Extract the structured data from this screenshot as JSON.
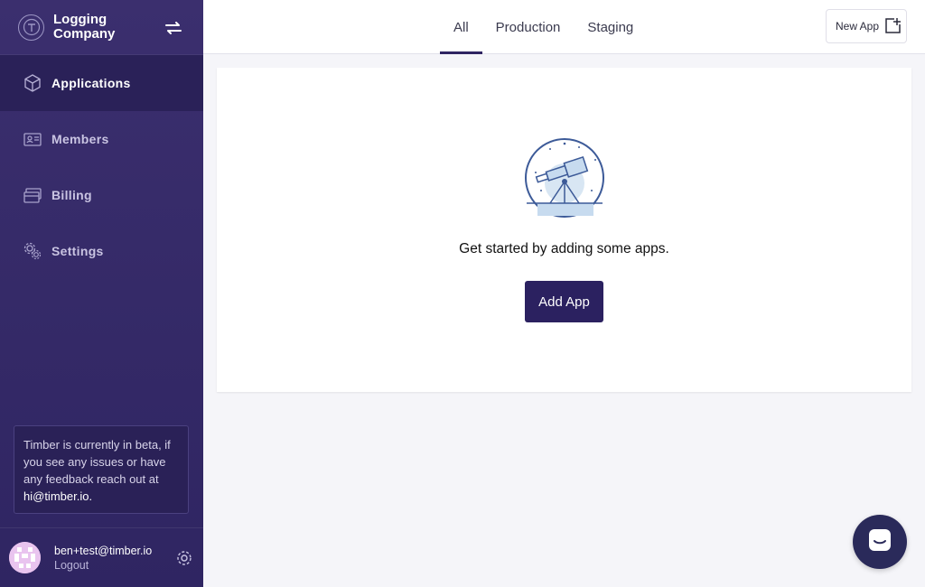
{
  "org": {
    "name": "Logging Company"
  },
  "nav": [
    {
      "label": "Applications",
      "icon": "cube-icon",
      "active": true
    },
    {
      "label": "Members",
      "icon": "id-card-icon"
    },
    {
      "label": "Billing",
      "icon": "credit-card-icon"
    },
    {
      "label": "Settings",
      "icon": "gear-icon"
    }
  ],
  "beta_notice": {
    "text": "Timber is currently in beta, if you see any issues or have any feedback reach out at",
    "email": "hi@timber.io."
  },
  "user": {
    "email": "ben+test@timber.io",
    "logout": "Logout"
  },
  "tabs": [
    {
      "label": "All",
      "active": true
    },
    {
      "label": "Production"
    },
    {
      "label": "Staging"
    }
  ],
  "new_app_label": "New App",
  "empty_state": {
    "message": "Get started by adding some apps.",
    "button": "Add App",
    "icon": "telescope-icon"
  },
  "colors": {
    "sidebar": "#3b2f6e",
    "accent": "#2b2160",
    "background": "#f5f5f9"
  }
}
